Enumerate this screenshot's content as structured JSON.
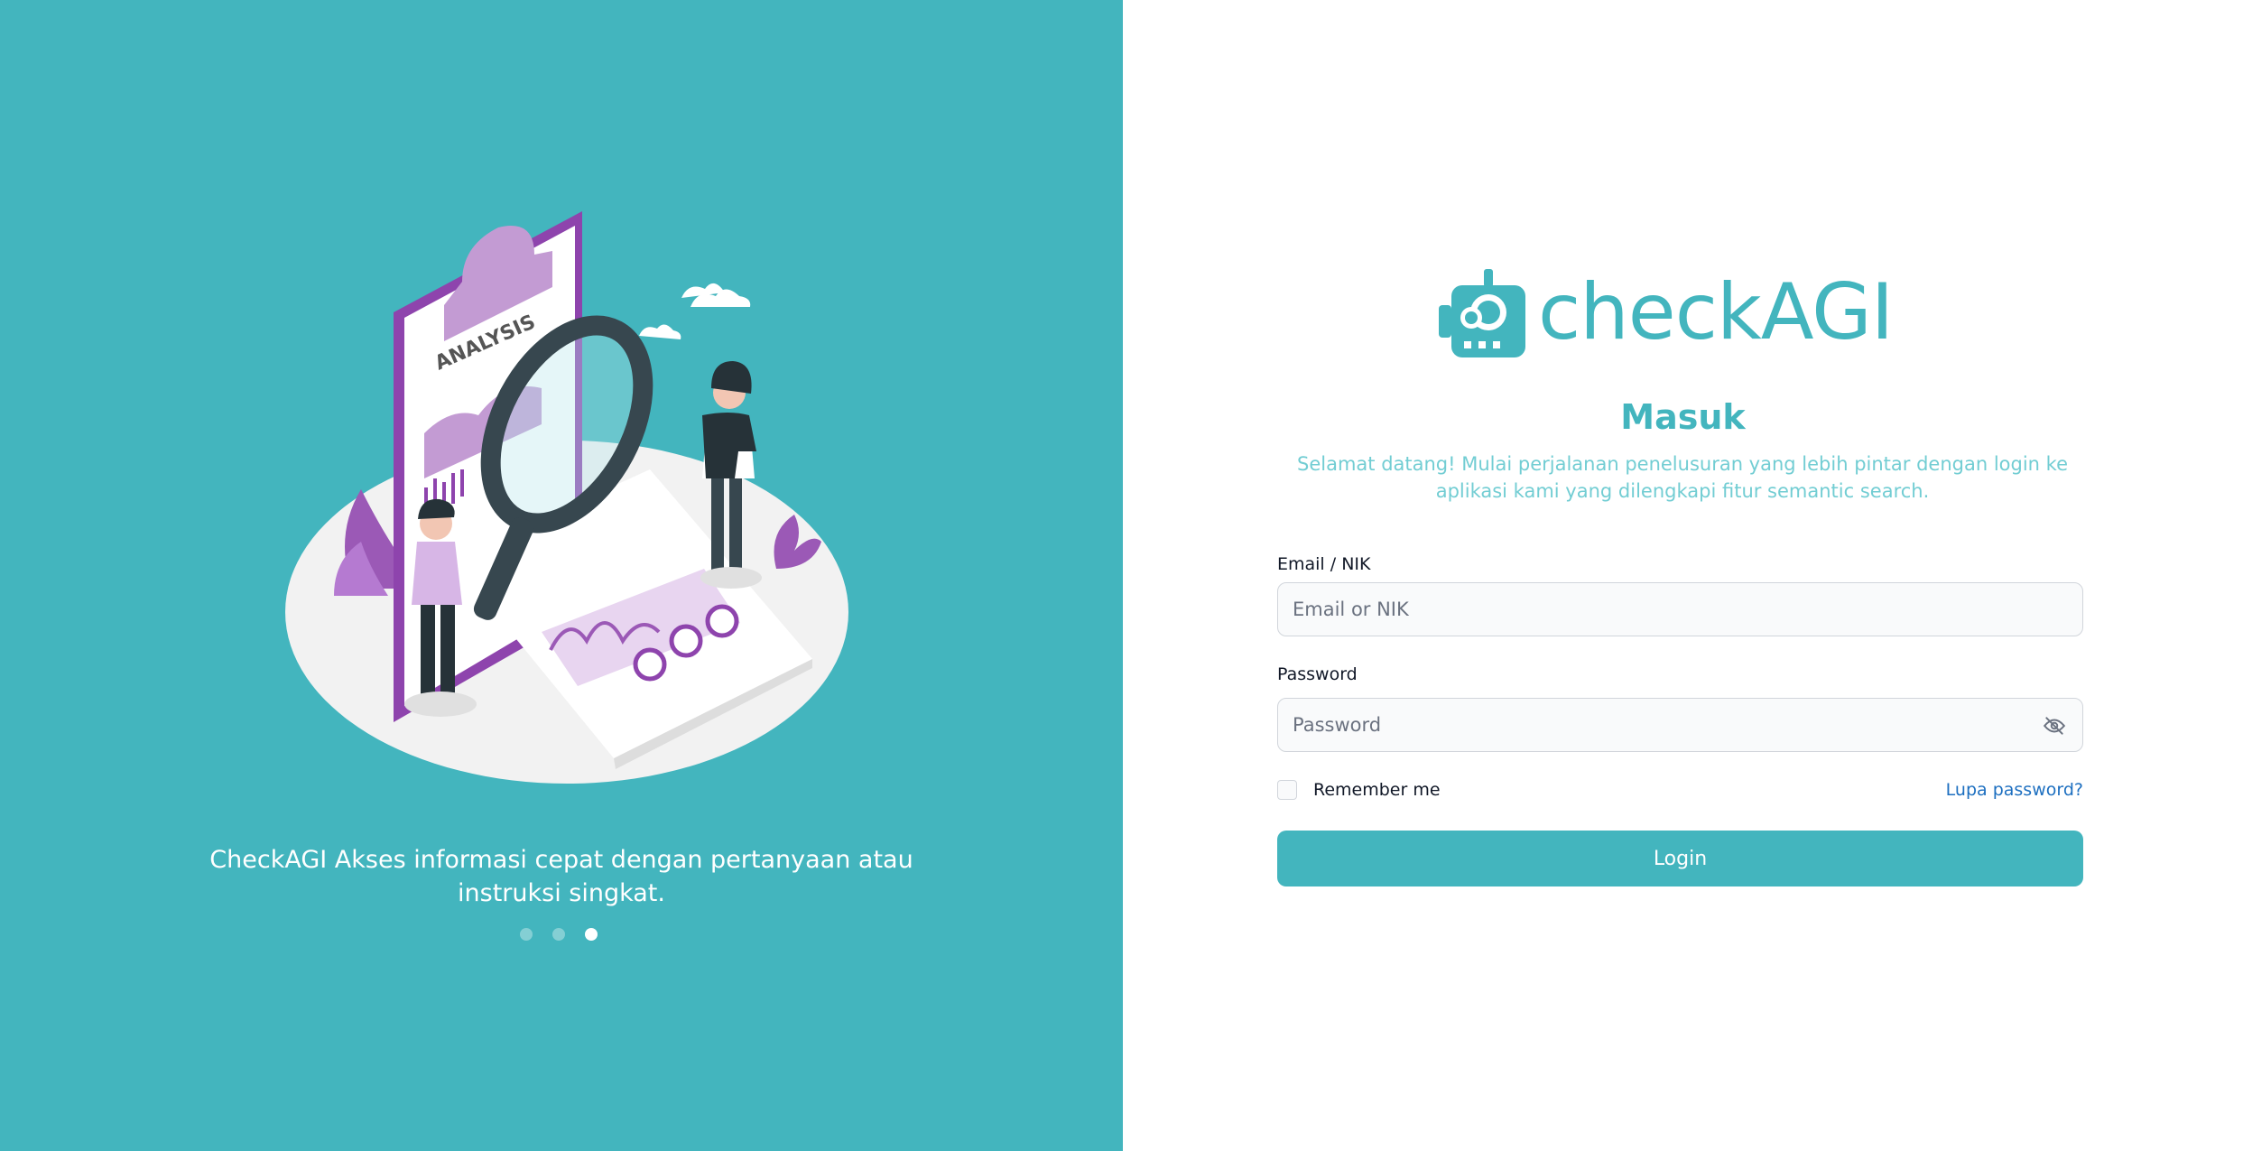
{
  "brand": {
    "name": "checkAGI",
    "color": "#43b5be"
  },
  "carousel": {
    "caption": "CheckAGI Akses informasi cepat dengan pertanyaan atau instruksi singkat.",
    "illustration_label": "ANALYSIS",
    "dots": 3,
    "active_dot": 3
  },
  "login": {
    "title": "Masuk",
    "subtitle": "Selamat datang! Mulai perjalanan penelusuran yang lebih pintar dengan login ke aplikasi kami yang dilengkapi fitur semantic search.",
    "email_label": "Email / NIK",
    "email_placeholder": "Email or NIK",
    "password_label": "Password",
    "password_placeholder": "Password",
    "password_toggle_icon": "eye-slash-icon",
    "remember_label": "Remember me",
    "forgot_label": "Lupa password?",
    "submit_label": "Login"
  }
}
